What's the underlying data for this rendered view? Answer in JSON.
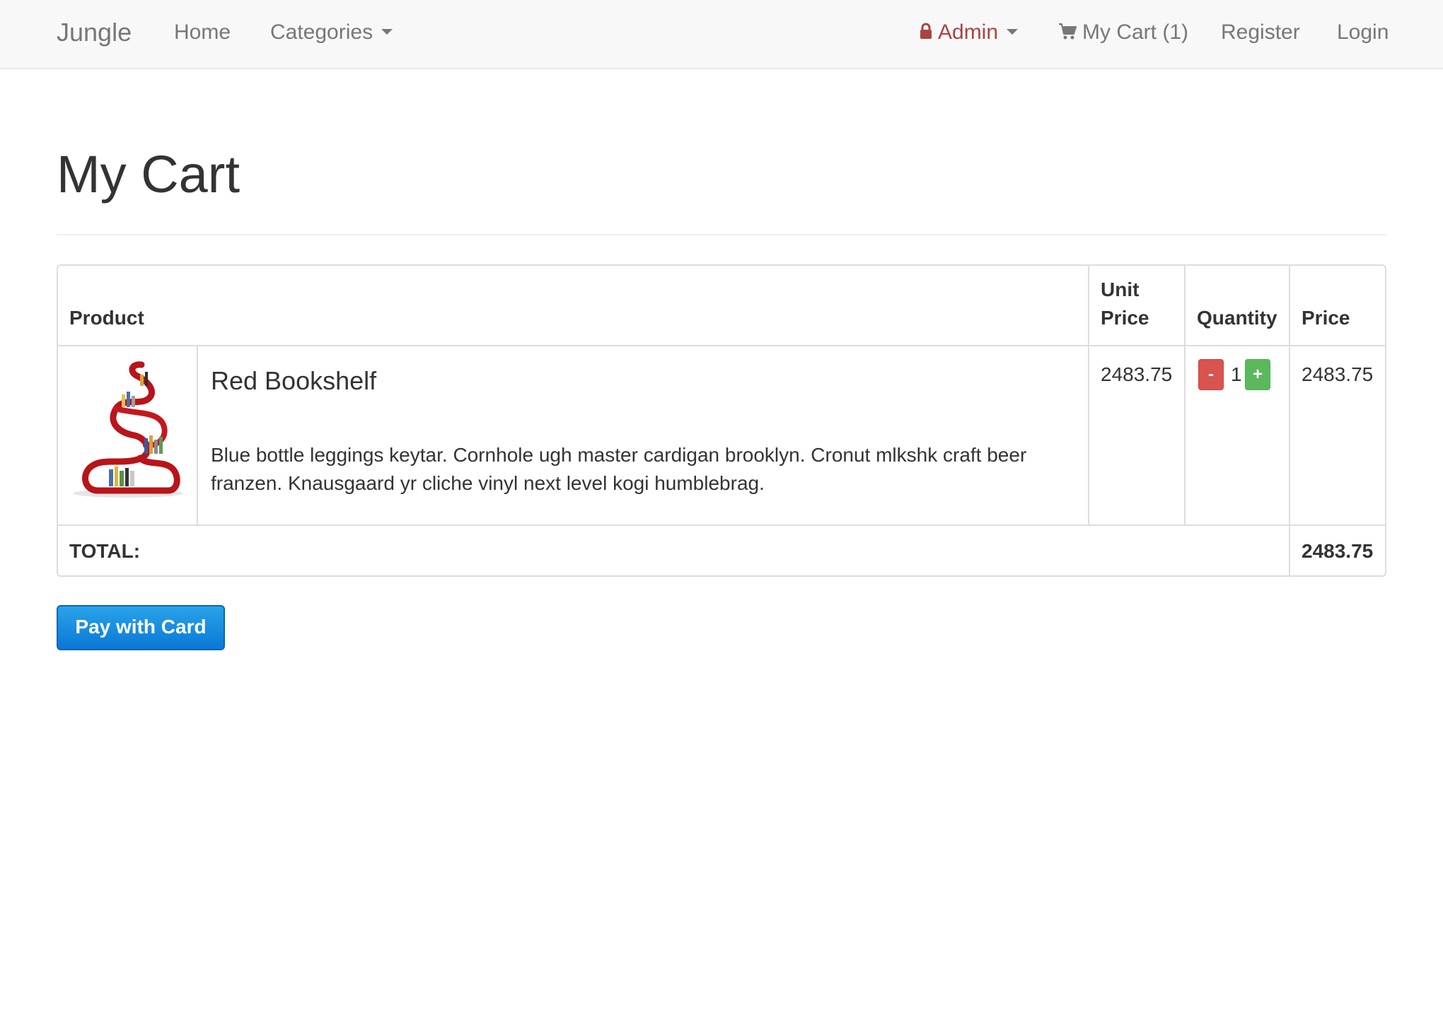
{
  "navbar": {
    "brand": "Jungle",
    "home": "Home",
    "categories": "Categories",
    "admin": "Admin",
    "cart": "My Cart (1)",
    "register": "Register",
    "login": "Login"
  },
  "page": {
    "title": "My Cart"
  },
  "table": {
    "headers": {
      "product": "Product",
      "unit_price_line1": "Unit",
      "unit_price_line2": "Price",
      "quantity": "Quantity",
      "price": "Price"
    },
    "items": [
      {
        "name": "Red Bookshelf",
        "description": "Blue bottle leggings keytar. Cornhole ugh master cardigan brooklyn. Cronut mlkshk craft beer franzen. Knausgaard yr cliche vinyl next level kogi humblebrag.",
        "unit_price": "2483.75",
        "quantity": "1",
        "price": "2483.75",
        "minus_label": "-",
        "plus_label": "+"
      }
    ],
    "total_label": "TOTAL:",
    "total_value": "2483.75"
  },
  "actions": {
    "pay_button": "Pay with Card"
  },
  "colors": {
    "admin": "#a94442",
    "minus_button": "#d9534f",
    "plus_button": "#5cb85c",
    "pay_button": "#1a8fe0"
  }
}
